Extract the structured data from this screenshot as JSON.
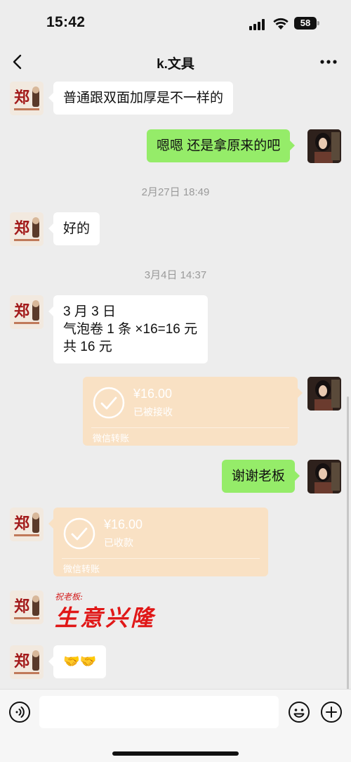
{
  "status_bar": {
    "time": "15:42",
    "battery": "58"
  },
  "nav": {
    "title": "k.文具"
  },
  "messages": {
    "m1": "普通跟双面加厚是不一样的",
    "m2": "嗯嗯 还是拿原来的吧",
    "ts1": "2月27日 18:49",
    "m3": "好的",
    "ts2": "3月4日 14:37",
    "m4_line1": "3 月 3 日",
    "m4_line2": "气泡卷 1 条 ×16=16 元",
    "m4_line3": "共 16 元",
    "m6": "谢谢老板",
    "m9": "🤝🤝"
  },
  "transfers": {
    "t1": {
      "amount": "¥16.00",
      "status": "已被接收",
      "footer": "微信转账"
    },
    "t2": {
      "amount": "¥16.00",
      "status": "已收款",
      "footer": "微信转账"
    }
  },
  "sticker": {
    "small": "祝老板:",
    "big": "生意兴隆"
  },
  "colors": {
    "bubble_green": "#95ec69",
    "transfer_bg": "#f9e1c4",
    "background": "#ededed"
  }
}
